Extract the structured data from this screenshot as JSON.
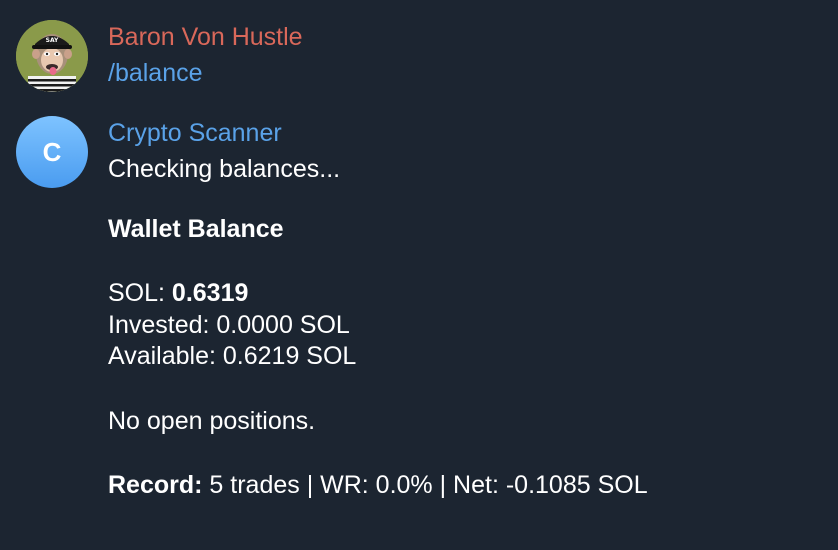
{
  "user_message": {
    "sender": "Baron Von Hustle",
    "text": "/balance",
    "avatar_icon": "ape-nft-avatar-icon",
    "sender_color": "#d9685a"
  },
  "bot_message": {
    "sender": "Crypto Scanner",
    "avatar_letter": "C",
    "sender_color": "#5aa2e8",
    "checking": "Checking balances...",
    "heading": "Wallet Balance",
    "sol_label": "SOL: ",
    "sol_value": "0.6319",
    "invested": "Invested: 0.0000 SOL",
    "available": "Available: 0.6219 SOL",
    "positions": "No open positions.",
    "record_label": "Record:",
    "record_value": " 5 trades | WR: 0.0% | Net: -0.1085 SOL"
  },
  "colors": {
    "background": "#1c2531",
    "link": "#5aa2e8"
  }
}
